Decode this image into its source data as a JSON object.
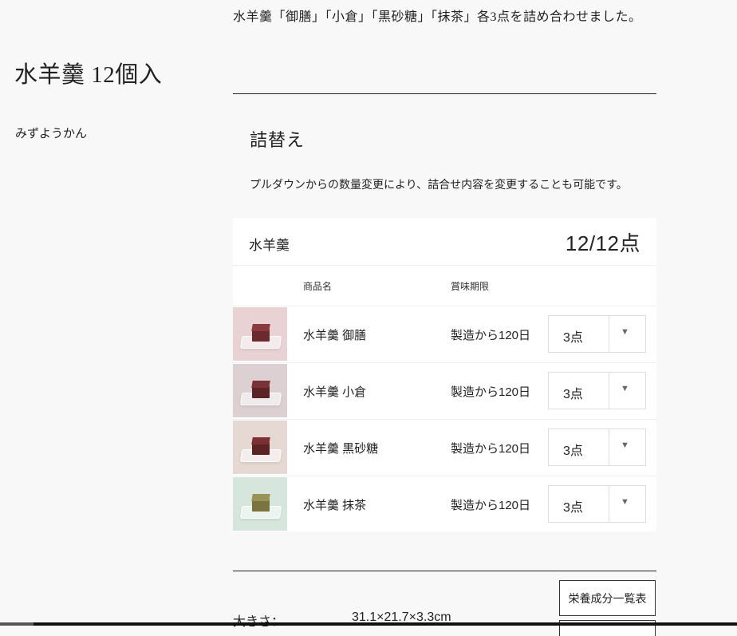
{
  "product": {
    "title": "水羊羹 12個入",
    "reading": "みずようかん",
    "description": "水羊羹「御膳」「小倉」「黒砂糖」「抹茶」各3点を詰め合わせました。"
  },
  "section": {
    "heading": "詰替え",
    "note": "プルダウンからの数量変更により、詰合せ内容を変更することも可能です。"
  },
  "set": {
    "name": "水羊羹",
    "count": "12/12点",
    "columns": {
      "name": "商品名",
      "expiry": "賞味期限"
    },
    "items": [
      {
        "name": "水羊羹 御膳",
        "expiry": "製造から120日",
        "qty": "3点",
        "bg": "#e8d2d4",
        "cake": "#6b2a2e",
        "cake_top": "#8a3b40"
      },
      {
        "name": "水羊羹 小倉",
        "expiry": "製造から120日",
        "qty": "3点",
        "bg": "#dcd0d2",
        "cake": "#5a2326",
        "cake_top": "#7a3236"
      },
      {
        "name": "水羊羹 黒砂糖",
        "expiry": "製造から120日",
        "qty": "3点",
        "bg": "#e6d8d2",
        "cake": "#5c2224",
        "cake_top": "#7c3034"
      },
      {
        "name": "水羊羹 抹茶",
        "expiry": "製造から120日",
        "qty": "3点",
        "bg": "#d6e6dc",
        "cake": "#7c7440",
        "cake_top": "#9a9358"
      }
    ]
  },
  "footer": {
    "size_label": "大きさ：",
    "size_value": "31.1×21.7×3.3cm",
    "nutrition_button": "栄養成分一覧表"
  },
  "icons": {
    "dropdown": "chevron-down-icon"
  }
}
